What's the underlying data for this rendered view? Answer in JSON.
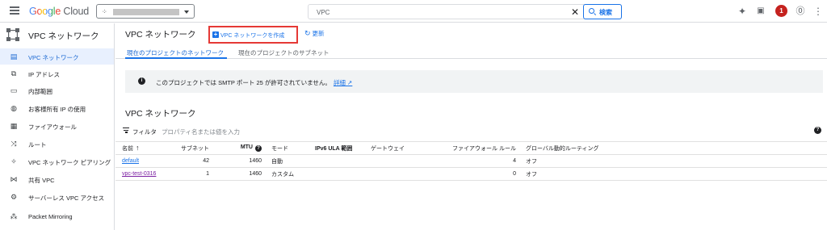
{
  "topbar": {
    "logo_google": "Google",
    "logo_cloud": "Cloud",
    "search_query": "VPC",
    "search_button": "検索",
    "notification_count": "1"
  },
  "sidebar": {
    "title": "VPC ネットワーク",
    "items": [
      {
        "label": "VPC ネットワーク",
        "icon": "network-icon",
        "active": true
      },
      {
        "label": "IP アドレス",
        "icon": "ip-address-icon"
      },
      {
        "label": "内部範囲",
        "icon": "internal-range-icon"
      },
      {
        "label": "お客様所有 IP の使用",
        "icon": "byoip-icon"
      },
      {
        "label": "ファイアウォール",
        "icon": "firewall-icon"
      },
      {
        "label": "ルート",
        "icon": "routes-icon"
      },
      {
        "label": "VPC ネットワーク ピアリング",
        "icon": "peering-icon"
      },
      {
        "label": "共有 VPC",
        "icon": "shared-vpc-icon"
      },
      {
        "label": "サーバーレス VPC アクセス",
        "icon": "serverless-icon"
      },
      {
        "label": "Packet Mirroring",
        "icon": "packet-mirroring-icon"
      }
    ]
  },
  "main": {
    "page_title": "VPC ネットワーク",
    "create_button": "VPC ネットワークを作成",
    "refresh_button": "更新",
    "tabs": [
      {
        "label": "現在のプロジェクトのネットワーク",
        "active": true
      },
      {
        "label": "現在のプロジェクトのサブネット"
      }
    ],
    "banner": {
      "message": "このプロジェクトでは SMTP ポート 25 が許可されていません。",
      "link": "詳細"
    },
    "section_title": "VPC ネットワーク",
    "filter": {
      "label": "フィルタ",
      "placeholder": "プロパティ名または値を入力"
    },
    "table": {
      "headers": [
        "名前",
        "サブネット",
        "MTU",
        "モード",
        "IPv6 ULA 範囲",
        "ゲートウェイ",
        "ファイアウォール ルール",
        "グローバル動的ルーティング"
      ],
      "rows": [
        [
          "default",
          "42",
          "1460",
          "自動",
          "",
          "",
          "4",
          "オフ"
        ],
        [
          "vpc-test-0316",
          "1",
          "1460",
          "カスタム",
          "",
          "",
          "0",
          "オフ"
        ]
      ]
    }
  },
  "colors": {
    "accent": "#1a73e8",
    "active_bg": "#e8f0fe",
    "highlight_box": "#e53935",
    "notification": "#c5221f"
  }
}
